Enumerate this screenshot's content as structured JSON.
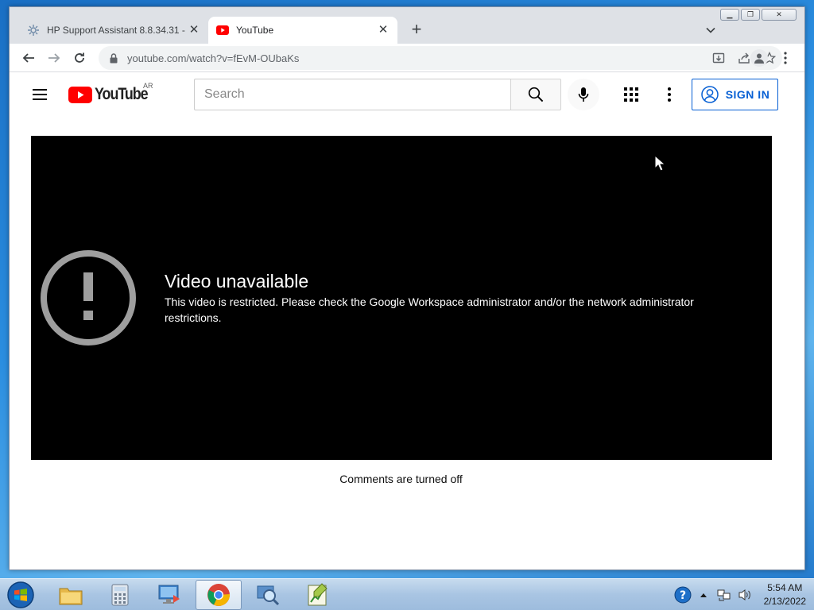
{
  "browser": {
    "tabs": [
      {
        "title": "HP Support Assistant 8.8.34.31 -",
        "active": false,
        "favicon": "gear-icon"
      },
      {
        "title": "YouTube",
        "active": true,
        "favicon": "youtube-icon"
      }
    ],
    "address_bar": {
      "url": "youtube.com/watch?v=fEvM-OUbaKs"
    }
  },
  "youtube": {
    "logo_text": "YouTube",
    "country_code": "AR",
    "search_placeholder": "Search",
    "signin_label": "SIGN IN",
    "error": {
      "title": "Video unavailable",
      "message": "This video is restricted. Please check the Google Workspace administrator and/or the network administrator restrictions."
    },
    "comments_status": "Comments are turned off"
  },
  "taskbar": {
    "apps": [
      "windows-explorer-icon",
      "calculator-icon",
      "remote-desktop-icon",
      "chrome-icon",
      "magnifier-icon",
      "notepad-chart-icon"
    ],
    "clock": {
      "time": "5:54 AM",
      "date": "2/13/2022"
    }
  },
  "colors": {
    "yt_red": "#ff0000",
    "link_blue": "#065fd4",
    "player_bg": "#000000"
  }
}
